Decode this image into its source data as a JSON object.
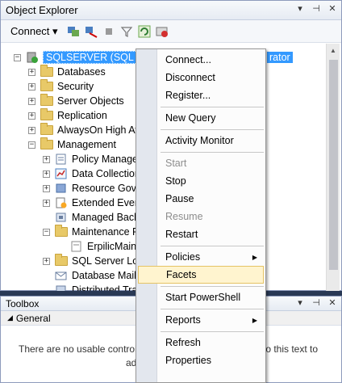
{
  "object_explorer": {
    "title": "Object Explorer",
    "connect_label": "Connect",
    "server_node": "SQLSERVER (SQL Serve",
    "server_node_tail": "rator",
    "tree": [
      {
        "label": "Databases"
      },
      {
        "label": "Security"
      },
      {
        "label": "Server Objects"
      },
      {
        "label": "Replication"
      },
      {
        "label": "AlwaysOn High Av"
      },
      {
        "label": "Management"
      },
      {
        "label": "Policy Manage"
      },
      {
        "label": "Data Collection"
      },
      {
        "label": "Resource Gove"
      },
      {
        "label": "Extended Event"
      },
      {
        "label": "Managed Back"
      },
      {
        "label": "Maintenance P"
      },
      {
        "label": "ErpilicMaint"
      },
      {
        "label": "SQL Server Log"
      },
      {
        "label": "Database Mail"
      },
      {
        "label": "Distributed Tra"
      }
    ]
  },
  "toolbox": {
    "title": "Toolbox",
    "group": "General",
    "message_left": "There are no usable controls",
    "message_right": "to this text to",
    "message_line2": "ad"
  },
  "context_menu": {
    "items": [
      {
        "label": "Connect...",
        "disabled": false
      },
      {
        "label": "Disconnect",
        "disabled": false
      },
      {
        "label": "Register...",
        "disabled": false
      },
      {
        "label": "New Query",
        "disabled": false
      },
      {
        "label": "Activity Monitor",
        "disabled": false
      },
      {
        "label": "Start",
        "disabled": true
      },
      {
        "label": "Stop",
        "disabled": false
      },
      {
        "label": "Pause",
        "disabled": false
      },
      {
        "label": "Resume",
        "disabled": true
      },
      {
        "label": "Restart",
        "disabled": false
      },
      {
        "label": "Policies",
        "disabled": false
      },
      {
        "label": "Facets",
        "disabled": false,
        "highlighted": true
      },
      {
        "label": "Start PowerShell",
        "disabled": false
      },
      {
        "label": "Reports",
        "disabled": false
      },
      {
        "label": "Refresh",
        "disabled": false
      },
      {
        "label": "Properties",
        "disabled": false
      }
    ]
  },
  "colors": {
    "selection": "#3399ff",
    "highlight_bg": "#fff4cf",
    "highlight_border": "#e5c365"
  }
}
